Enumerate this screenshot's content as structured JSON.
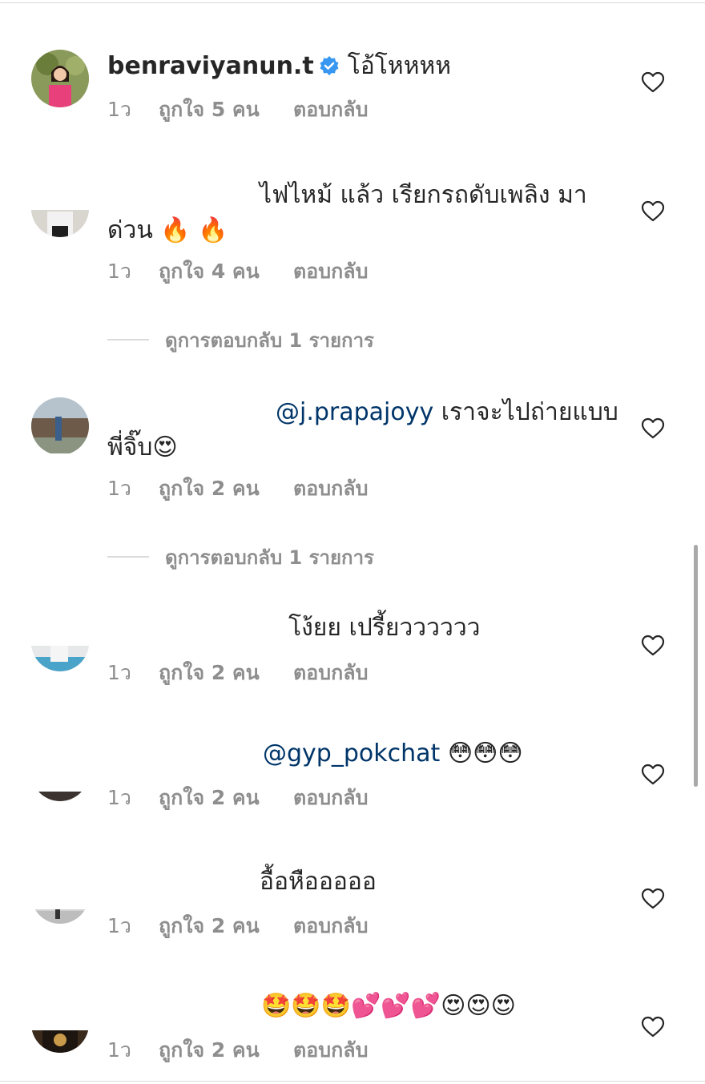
{
  "comments": [
    {
      "username": "benraviyanun.t",
      "text": "โอ้โหหหห",
      "time": "1ว",
      "likes": "ถูกใจ 5 คน",
      "reply": "ตอบกลับ"
    },
    {
      "text": "ไฟไหม้ แล้ว เรียกรถดับเพลิง มา ด่วน",
      "emoji": "🔥 🔥",
      "time": "1ว",
      "likes": "ถูกใจ 4 คน",
      "reply": "ตอบกลับ",
      "view_replies": "ดูการตอบกลับ 1 รายการ"
    },
    {
      "mention": "@j.prapajoyy",
      "text": " เราจะไปถ่ายแบบพี่จิ๊บ",
      "emoji": "😍",
      "time": "1ว",
      "likes": "ถูกใจ 2 คน",
      "reply": "ตอบกลับ",
      "view_replies": "ดูการตอบกลับ 1 รายการ"
    },
    {
      "text": "โง้ยย เปรี้ยวววววว",
      "time": "1ว",
      "likes": "ถูกใจ 2 คน",
      "reply": "ตอบกลับ"
    },
    {
      "mention": "@gyp_pokchat",
      "emoji": "😳😳😳",
      "time": "1ว",
      "likes": "ถูกใจ 2 คน",
      "reply": "ตอบกลับ"
    },
    {
      "text": "อื้อหือออออ",
      "time": "1ว",
      "likes": "ถูกใจ 2 คน",
      "reply": "ตอบกลับ"
    },
    {
      "emoji": "🤩🤩🤩💕💕💕😍😍😍",
      "time": "1ว",
      "likes": "ถูกใจ 2 คน",
      "reply": "ตอบกลับ"
    }
  ],
  "colors": {
    "text": "#262626",
    "meta": "#8e8e8e",
    "mention": "#003569",
    "verified": "#3897f0",
    "divider": "#dbdbdb"
  },
  "icons": {
    "like": "heart-outline-icon",
    "verified": "verified-badge-icon"
  }
}
